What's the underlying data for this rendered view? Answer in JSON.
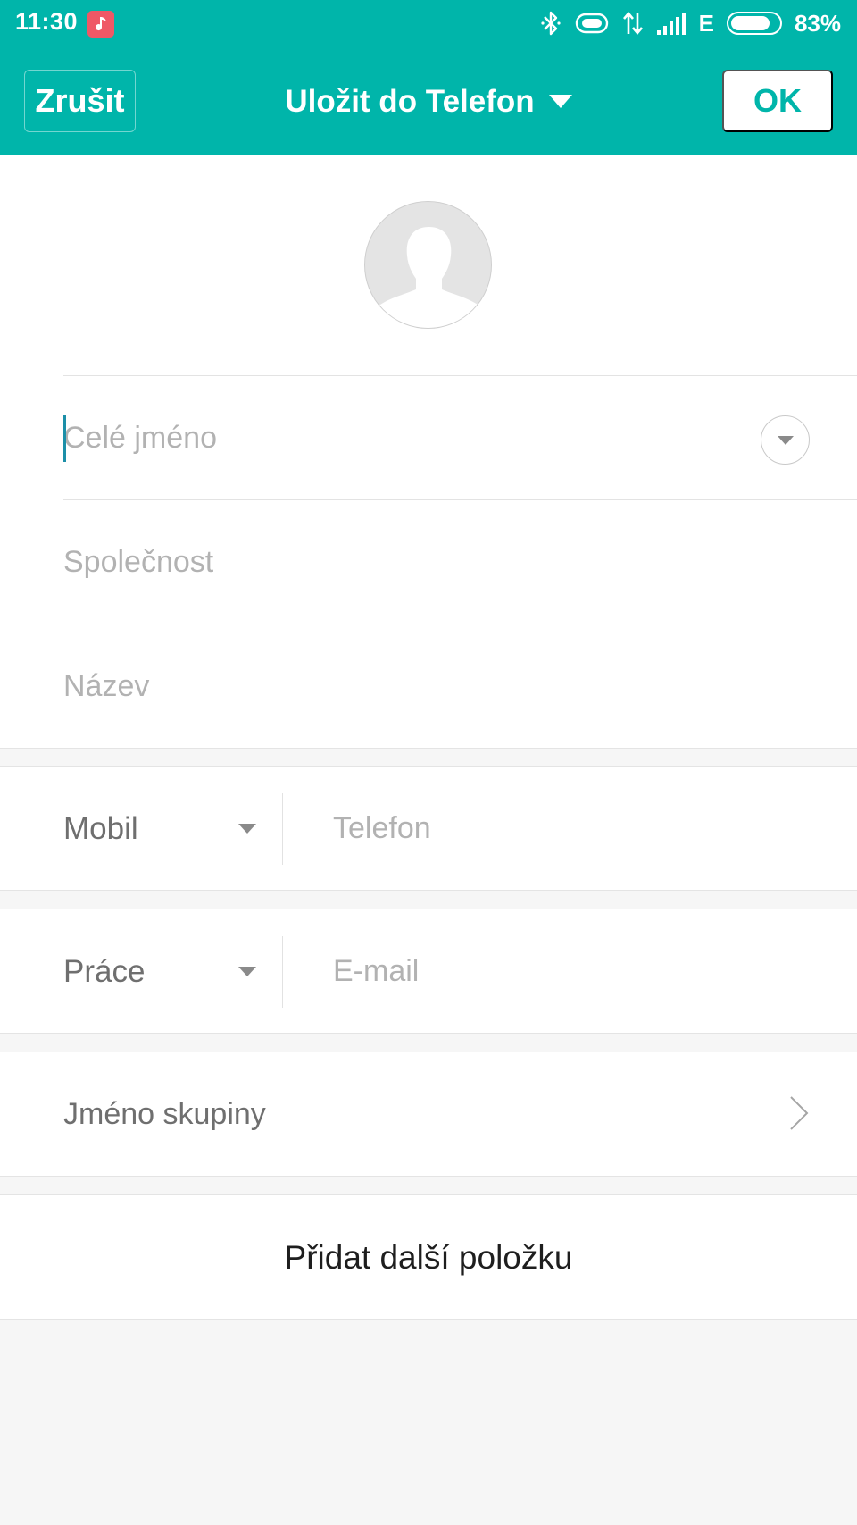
{
  "status_bar": {
    "time": "11:30",
    "app_icon": "music-note-icon",
    "network_type": "E",
    "battery_percent": "83%",
    "battery_level": 0.83,
    "icons": [
      "bluetooth-icon",
      "vibrate-icon",
      "data-transfer-icon",
      "signal-icon",
      "battery-icon"
    ]
  },
  "header": {
    "cancel_label": "Zrušit",
    "title": "Uložit do Telefon",
    "ok_label": "OK"
  },
  "colors": {
    "accent": "#00b5aa",
    "placeholder": "#b2b2b2",
    "label": "#6f6f6f",
    "background": "#f6f6f6"
  },
  "contact": {
    "avatar_icon": "person-silhouette-icon",
    "fields": {
      "full_name_placeholder": "Celé jméno",
      "company_placeholder": "Společnost",
      "title_placeholder": "Název"
    },
    "phone": {
      "type": "Mobil",
      "placeholder": "Telefon"
    },
    "email": {
      "type": "Práce",
      "placeholder": "E-mail"
    },
    "group_label": "Jméno skupiny",
    "add_more_label": "Přidat další položku"
  }
}
